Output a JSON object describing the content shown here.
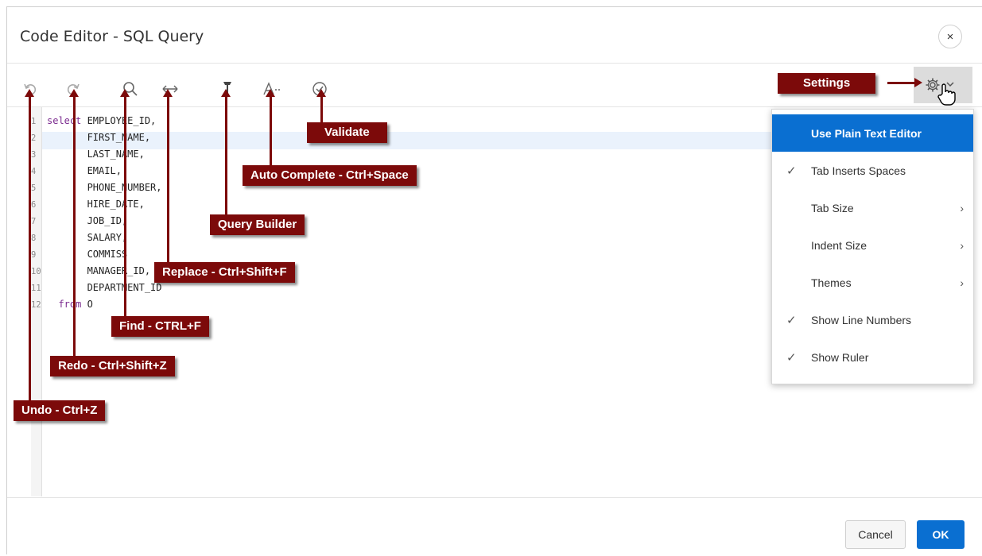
{
  "dialog": {
    "title": "Code Editor - SQL Query",
    "close_label": "×"
  },
  "toolbar": {
    "icons": [
      "undo-icon",
      "redo-icon",
      "search-icon",
      "replace-icon",
      "query-builder-icon",
      "autocomplete-icon",
      "validate-icon",
      "gear-icon",
      "chevron-down-icon"
    ]
  },
  "editor": {
    "line_numbers": [
      "1",
      "2",
      "3",
      "4",
      "5",
      "6",
      "7",
      "8",
      "9",
      "10",
      "11",
      "12"
    ],
    "lines": [
      {
        "kw": "select",
        "text": " EMPLOYEE_ID,"
      },
      {
        "kw": "",
        "text": "       FIRST_NAME,"
      },
      {
        "kw": "",
        "text": "       LAST_NAME,"
      },
      {
        "kw": "",
        "text": "       EMAIL,"
      },
      {
        "kw": "",
        "text": "       PHONE_NUMBER,"
      },
      {
        "kw": "",
        "text": "       HIRE_DATE,"
      },
      {
        "kw": "",
        "text": "       JOB_ID,"
      },
      {
        "kw": "",
        "text": "       SALARY,"
      },
      {
        "kw": "",
        "text": "       COMMISS"
      },
      {
        "kw": "",
        "text": "       MANAGER_ID,"
      },
      {
        "kw": "",
        "text": "       DEPARTMENT_ID"
      },
      {
        "kw": "  from",
        "text": " O"
      }
    ]
  },
  "settings_menu": {
    "items": [
      {
        "label": "Use Plain Text Editor",
        "checked": false,
        "submenu": false,
        "active": true
      },
      {
        "label": "Tab Inserts Spaces",
        "checked": true,
        "submenu": false,
        "active": false
      },
      {
        "label": "Tab Size",
        "checked": false,
        "submenu": true,
        "active": false
      },
      {
        "label": "Indent Size",
        "checked": false,
        "submenu": true,
        "active": false
      },
      {
        "label": "Themes",
        "checked": false,
        "submenu": true,
        "active": false
      },
      {
        "label": "Show Line Numbers",
        "checked": true,
        "submenu": false,
        "active": false
      },
      {
        "label": "Show Ruler",
        "checked": true,
        "submenu": false,
        "active": false
      }
    ]
  },
  "footer": {
    "cancel_label": "Cancel",
    "ok_label": "OK"
  },
  "callouts": {
    "settings": "Settings",
    "validate": "Validate",
    "auto_complete": "Auto Complete - Ctrl+Space",
    "query_builder": "Query Builder",
    "replace": "Replace - Ctrl+Shift+F",
    "find": "Find - CTRL+F",
    "redo": "Redo - Ctrl+Shift+Z",
    "undo": "Undo - Ctrl+Z"
  },
  "colors": {
    "accent": "#0a6fd1",
    "callout": "#7c0a0a",
    "keyword": "#7b2b8f"
  }
}
